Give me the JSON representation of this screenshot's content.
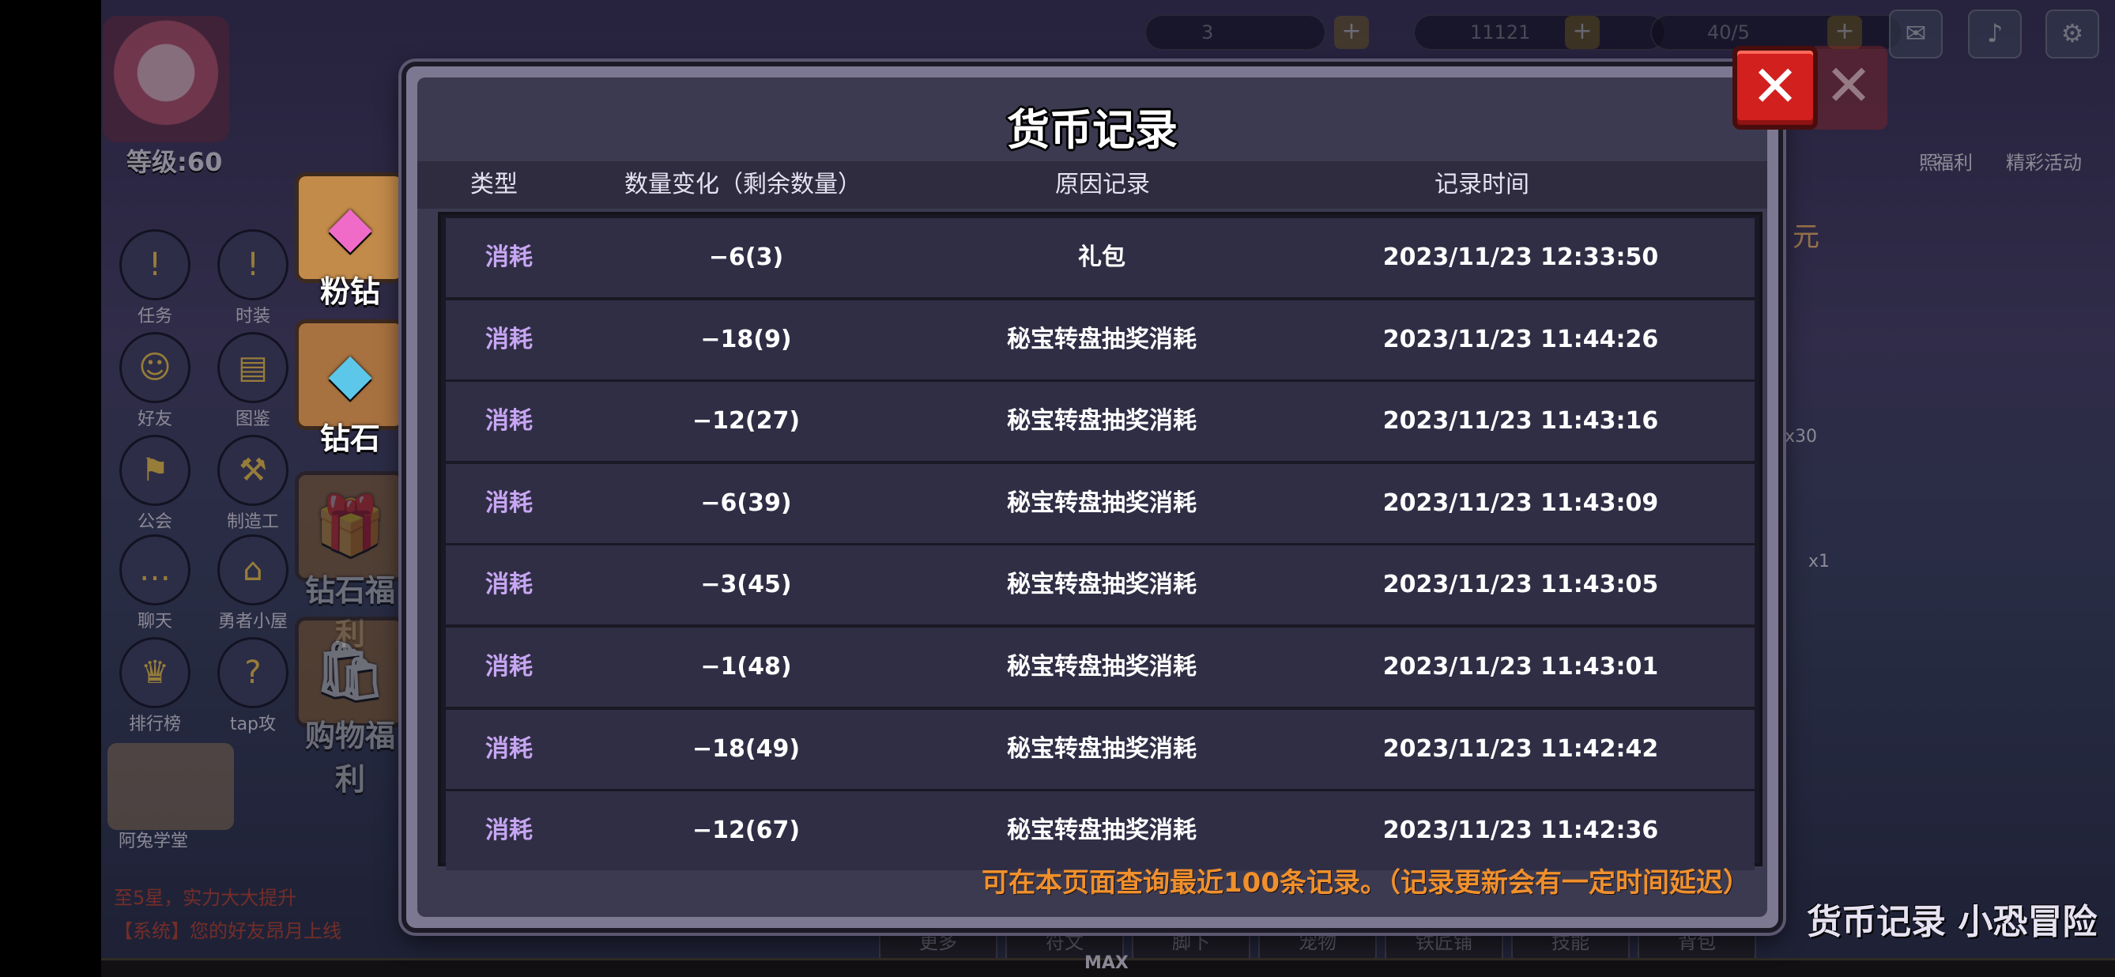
{
  "dialog": {
    "title": "货币记录",
    "columns": [
      "类型",
      "数量变化（剩余数量）",
      "原因记录",
      "记录时间"
    ],
    "rows": [
      {
        "type": "消耗",
        "change": "−6(3)",
        "reason": "礼包",
        "time": "2023/11/23 12:33:50"
      },
      {
        "type": "消耗",
        "change": "−18(9)",
        "reason": "秘宝转盘抽奖消耗",
        "time": "2023/11/23 11:44:26"
      },
      {
        "type": "消耗",
        "change": "−12(27)",
        "reason": "秘宝转盘抽奖消耗",
        "time": "2023/11/23 11:43:16"
      },
      {
        "type": "消耗",
        "change": "−6(39)",
        "reason": "秘宝转盘抽奖消耗",
        "time": "2023/11/23 11:43:09"
      },
      {
        "type": "消耗",
        "change": "−3(45)",
        "reason": "秘宝转盘抽奖消耗",
        "time": "2023/11/23 11:43:05"
      },
      {
        "type": "消耗",
        "change": "−1(48)",
        "reason": "秘宝转盘抽奖消耗",
        "time": "2023/11/23 11:43:01"
      },
      {
        "type": "消耗",
        "change": "−18(49)",
        "reason": "秘宝转盘抽奖消耗",
        "time": "2023/11/23 11:42:42"
      },
      {
        "type": "消耗",
        "change": "−12(67)",
        "reason": "秘宝转盘抽奖消耗",
        "time": "2023/11/23 11:42:36"
      }
    ],
    "footnote": "可在本页面查询最近100条记录。（记录更新会有一定时间延迟）",
    "close_symbol": "✕"
  },
  "currency_tabs": [
    {
      "label": "粉钻",
      "icon": "pink-diamond-icon",
      "color": "#f06bc8"
    },
    {
      "label": "钻石",
      "icon": "blue-diamond-icon",
      "color": "#5cc7e8"
    }
  ],
  "background": {
    "level": "等级:60",
    "left_buttons": [
      {
        "label": "任务",
        "glyph": "!"
      },
      {
        "label": "时装",
        "glyph": "!"
      },
      {
        "label": "好友",
        "glyph": "☺"
      },
      {
        "label": "图鉴",
        "glyph": "▤"
      },
      {
        "label": "公会",
        "glyph": "⚑"
      },
      {
        "label": "制造工",
        "glyph": "⚒"
      },
      {
        "label": "聊天",
        "glyph": "…"
      },
      {
        "label": "勇者小屋",
        "glyph": "⌂"
      },
      {
        "label": "排行榜",
        "glyph": "♛"
      },
      {
        "label": "tap攻",
        "glyph": "?"
      }
    ],
    "menu_tiles": [
      "钻石福利",
      "购物福利"
    ],
    "mascot_label": "阿兔学堂",
    "chat_lines": [
      "至5星，实力大大提升",
      "【系统】您的好友昂月上线"
    ],
    "resource_values": [
      "3",
      "11121",
      "40/5"
    ],
    "right_labels": [
      "照",
      "福利",
      "精彩活动",
      "x30",
      "x1",
      "元"
    ],
    "bottom_tabs": [
      "更多",
      "符文",
      "脚下",
      "宠物",
      "铁匠铺",
      "技能",
      "背包"
    ],
    "max_text": "MAX",
    "watermark": "货币记录 小恐冒险"
  },
  "colors": {
    "type_text": "#c7a6f2",
    "footnote": "#f0902c",
    "close_button": "#d2201f",
    "dialog_bg": "#3c3a50",
    "row_bg": "#302e45"
  }
}
